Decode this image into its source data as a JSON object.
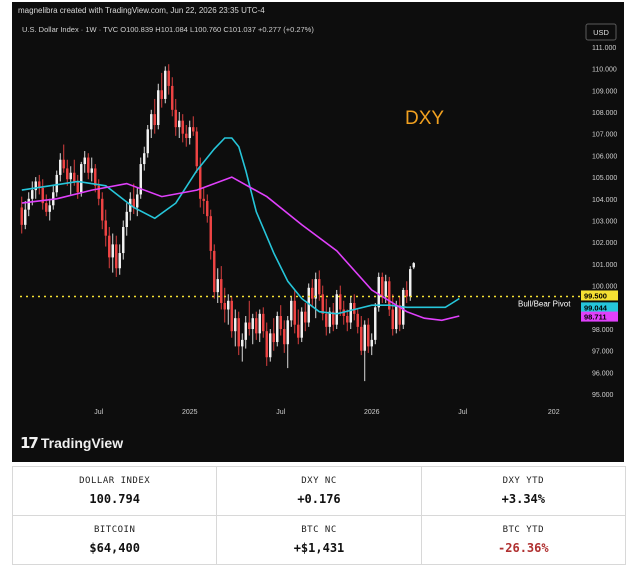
{
  "credit": "magnelibra created with TradingView.com, Jun 22, 2026 23:35 UTC-4",
  "brand": "TradingView",
  "chart_data": {
    "type": "candlestick",
    "header": "U.S. Dollar Index · 1W · TVC",
    "ohlc_text": {
      "o_label": "O",
      "o": "100.839",
      "h_label": "H",
      "h": "101.084",
      "l_label": "L",
      "l": "100.760",
      "c_label": "C",
      "c": "101.037",
      "change": "+0.277 (+0.27%)"
    },
    "currency_button": "USD",
    "annotation": "DXY",
    "pivot_label": "Bull/Bear Pivot",
    "pivot_value": 99.5,
    "ylim": [
      94.5,
      111.5
    ],
    "y_ticks": [
      "111.000",
      "110.000",
      "109.000",
      "108.000",
      "107.000",
      "106.000",
      "105.000",
      "104.000",
      "103.000",
      "102.000",
      "101.000",
      "100.000",
      "99.000",
      "98.000",
      "97.000",
      "96.000",
      "95.000"
    ],
    "x_ticks": [
      {
        "label": "Jul",
        "index": 22
      },
      {
        "label": "2025",
        "index": 48
      },
      {
        "label": "Jul",
        "index": 74
      },
      {
        "label": "2026",
        "index": 100
      },
      {
        "label": "Jul",
        "index": 126
      },
      {
        "label": "202",
        "index": 152
      }
    ],
    "price_tags": [
      {
        "label": "99.500",
        "value": 99.5,
        "color": "#f5e133",
        "text": "#000000"
      },
      {
        "label": "99.044",
        "value": 99.044,
        "color": "#26c6da",
        "text": "#000000"
      },
      {
        "label": "98.711",
        "value": 98.711,
        "color": "#e040fb",
        "text": "#000000"
      }
    ],
    "series": [
      {
        "role": "short-ma",
        "color": "#26c6da",
        "x": [
          0,
          8,
          16,
          24,
          32,
          38,
          44,
          50,
          55,
          58,
          60,
          62,
          64,
          67,
          72,
          76,
          80,
          85,
          90,
          95,
          100,
          105,
          110,
          115,
          119,
          121,
          123,
          125
        ],
        "y": [
          104.4,
          104.6,
          104.8,
          104.6,
          103.6,
          103.1,
          103.8,
          105.3,
          106.3,
          106.8,
          106.8,
          106.4,
          105.3,
          103.4,
          101.5,
          100.2,
          99.4,
          98.8,
          98.7,
          98.9,
          99.1,
          99.1,
          99.0,
          99.0,
          99.0,
          99.0,
          99.2,
          99.4
        ]
      },
      {
        "role": "long-ma",
        "color": "#e040fb",
        "x": [
          0,
          10,
          20,
          30,
          40,
          50,
          60,
          70,
          80,
          90,
          100,
          110,
          115,
          120,
          125
        ],
        "y": [
          103.8,
          104.0,
          104.4,
          104.7,
          104.1,
          104.4,
          105.0,
          104.1,
          102.8,
          101.6,
          99.8,
          98.8,
          98.5,
          98.4,
          98.6
        ]
      }
    ],
    "candles": [
      {
        "o": 103.6,
        "h": 104.1,
        "l": 102.4,
        "c": 102.8
      },
      {
        "o": 102.8,
        "h": 103.9,
        "l": 102.6,
        "c": 103.5
      },
      {
        "o": 103.5,
        "h": 104.3,
        "l": 103.2,
        "c": 104.0
      },
      {
        "o": 104.0,
        "h": 104.8,
        "l": 103.7,
        "c": 104.4
      },
      {
        "o": 104.4,
        "h": 105.0,
        "l": 104.0,
        "c": 104.8
      },
      {
        "o": 104.8,
        "h": 105.1,
        "l": 104.2,
        "c": 104.5
      },
      {
        "o": 104.5,
        "h": 104.9,
        "l": 103.5,
        "c": 103.8
      },
      {
        "o": 103.8,
        "h": 104.2,
        "l": 103.2,
        "c": 103.4
      },
      {
        "o": 103.4,
        "h": 104.0,
        "l": 103.0,
        "c": 103.7
      },
      {
        "o": 103.7,
        "h": 104.6,
        "l": 103.5,
        "c": 104.3
      },
      {
        "o": 104.3,
        "h": 105.3,
        "l": 104.1,
        "c": 105.1
      },
      {
        "o": 105.1,
        "h": 106.1,
        "l": 104.8,
        "c": 105.8
      },
      {
        "o": 105.8,
        "h": 106.5,
        "l": 105.2,
        "c": 105.4
      },
      {
        "o": 105.4,
        "h": 105.8,
        "l": 104.6,
        "c": 104.9
      },
      {
        "o": 104.9,
        "h": 105.5,
        "l": 104.2,
        "c": 105.2
      },
      {
        "o": 105.2,
        "h": 105.8,
        "l": 104.6,
        "c": 104.8
      },
      {
        "o": 104.8,
        "h": 105.1,
        "l": 104.0,
        "c": 104.3
      },
      {
        "o": 104.3,
        "h": 105.7,
        "l": 104.1,
        "c": 105.6
      },
      {
        "o": 105.6,
        "h": 106.2,
        "l": 105.2,
        "c": 105.9
      },
      {
        "o": 105.9,
        "h": 106.1,
        "l": 104.9,
        "c": 105.2
      },
      {
        "o": 105.2,
        "h": 105.9,
        "l": 104.8,
        "c": 105.4
      },
      {
        "o": 105.4,
        "h": 105.6,
        "l": 104.3,
        "c": 104.6
      },
      {
        "o": 104.6,
        "h": 104.9,
        "l": 103.7,
        "c": 104.0
      },
      {
        "o": 104.0,
        "h": 104.3,
        "l": 102.6,
        "c": 103.0
      },
      {
        "o": 103.0,
        "h": 103.5,
        "l": 101.8,
        "c": 102.3
      },
      {
        "o": 102.3,
        "h": 102.7,
        "l": 100.8,
        "c": 101.3
      },
      {
        "o": 101.3,
        "h": 102.4,
        "l": 100.6,
        "c": 101.9
      },
      {
        "o": 101.9,
        "h": 102.3,
        "l": 100.4,
        "c": 100.8
      },
      {
        "o": 100.8,
        "h": 101.9,
        "l": 100.5,
        "c": 101.5
      },
      {
        "o": 101.5,
        "h": 103.0,
        "l": 101.2,
        "c": 102.7
      },
      {
        "o": 102.7,
        "h": 103.8,
        "l": 102.3,
        "c": 103.4
      },
      {
        "o": 103.4,
        "h": 104.3,
        "l": 103.0,
        "c": 104.0
      },
      {
        "o": 104.0,
        "h": 104.7,
        "l": 103.3,
        "c": 103.6
      },
      {
        "o": 103.6,
        "h": 104.5,
        "l": 103.2,
        "c": 104.2
      },
      {
        "o": 104.2,
        "h": 105.9,
        "l": 104.0,
        "c": 105.6
      },
      {
        "o": 105.6,
        "h": 106.4,
        "l": 105.3,
        "c": 106.1
      },
      {
        "o": 106.1,
        "h": 107.4,
        "l": 105.9,
        "c": 107.2
      },
      {
        "o": 107.2,
        "h": 108.1,
        "l": 106.8,
        "c": 107.9
      },
      {
        "o": 107.9,
        "h": 108.6,
        "l": 107.0,
        "c": 107.4
      },
      {
        "o": 107.4,
        "h": 109.3,
        "l": 107.2,
        "c": 109.0
      },
      {
        "o": 109.0,
        "h": 109.8,
        "l": 108.2,
        "c": 108.6
      },
      {
        "o": 108.6,
        "h": 110.1,
        "l": 108.4,
        "c": 109.9
      },
      {
        "o": 109.9,
        "h": 110.2,
        "l": 108.8,
        "c": 109.2
      },
      {
        "o": 109.2,
        "h": 109.6,
        "l": 107.8,
        "c": 108.1
      },
      {
        "o": 108.1,
        "h": 108.6,
        "l": 106.9,
        "c": 107.3
      },
      {
        "o": 107.3,
        "h": 108.0,
        "l": 106.8,
        "c": 107.6
      },
      {
        "o": 107.6,
        "h": 107.9,
        "l": 106.6,
        "c": 107.0
      },
      {
        "o": 107.0,
        "h": 107.4,
        "l": 106.4,
        "c": 106.8
      },
      {
        "o": 106.8,
        "h": 107.6,
        "l": 106.5,
        "c": 107.3
      },
      {
        "o": 107.3,
        "h": 107.8,
        "l": 106.9,
        "c": 107.1
      },
      {
        "o": 107.1,
        "h": 107.3,
        "l": 105.2,
        "c": 105.5
      },
      {
        "o": 105.5,
        "h": 105.9,
        "l": 103.6,
        "c": 104.0
      },
      {
        "o": 104.0,
        "h": 104.5,
        "l": 103.3,
        "c": 103.9
      },
      {
        "o": 103.9,
        "h": 104.2,
        "l": 102.9,
        "c": 103.2
      },
      {
        "o": 103.2,
        "h": 103.5,
        "l": 101.2,
        "c": 101.6
      },
      {
        "o": 101.6,
        "h": 101.9,
        "l": 99.4,
        "c": 99.7
      },
      {
        "o": 99.7,
        "h": 100.8,
        "l": 99.2,
        "c": 100.3
      },
      {
        "o": 100.3,
        "h": 100.9,
        "l": 98.9,
        "c": 99.2
      },
      {
        "o": 99.2,
        "h": 99.9,
        "l": 98.3,
        "c": 98.9
      },
      {
        "o": 98.9,
        "h": 99.6,
        "l": 98.2,
        "c": 99.3
      },
      {
        "o": 99.3,
        "h": 99.5,
        "l": 97.6,
        "c": 97.9
      },
      {
        "o": 97.9,
        "h": 98.9,
        "l": 97.2,
        "c": 98.5
      },
      {
        "o": 98.5,
        "h": 98.8,
        "l": 96.8,
        "c": 97.2
      },
      {
        "o": 97.2,
        "h": 97.8,
        "l": 96.5,
        "c": 97.5
      },
      {
        "o": 97.5,
        "h": 98.6,
        "l": 97.1,
        "c": 98.3
      },
      {
        "o": 98.3,
        "h": 99.3,
        "l": 97.7,
        "c": 98.0
      },
      {
        "o": 98.0,
        "h": 98.7,
        "l": 97.3,
        "c": 98.5
      },
      {
        "o": 98.5,
        "h": 98.8,
        "l": 97.5,
        "c": 97.8
      },
      {
        "o": 97.8,
        "h": 98.9,
        "l": 97.4,
        "c": 98.7
      },
      {
        "o": 98.7,
        "h": 99.0,
        "l": 97.6,
        "c": 97.9
      },
      {
        "o": 97.9,
        "h": 98.3,
        "l": 96.3,
        "c": 96.7
      },
      {
        "o": 96.7,
        "h": 98.0,
        "l": 96.5,
        "c": 97.8
      },
      {
        "o": 97.8,
        "h": 98.5,
        "l": 97.0,
        "c": 97.4
      },
      {
        "o": 97.4,
        "h": 98.8,
        "l": 97.2,
        "c": 98.6
      },
      {
        "o": 98.6,
        "h": 99.1,
        "l": 97.7,
        "c": 98.0
      },
      {
        "o": 98.0,
        "h": 98.4,
        "l": 96.9,
        "c": 97.3
      },
      {
        "o": 97.3,
        "h": 98.6,
        "l": 96.2,
        "c": 98.4
      },
      {
        "o": 98.4,
        "h": 99.5,
        "l": 98.1,
        "c": 99.3
      },
      {
        "o": 99.3,
        "h": 99.8,
        "l": 97.8,
        "c": 98.2
      },
      {
        "o": 98.2,
        "h": 98.9,
        "l": 97.3,
        "c": 97.6
      },
      {
        "o": 97.6,
        "h": 99.0,
        "l": 97.4,
        "c": 98.8
      },
      {
        "o": 98.8,
        "h": 99.2,
        "l": 97.9,
        "c": 98.3
      },
      {
        "o": 98.3,
        "h": 100.1,
        "l": 98.1,
        "c": 99.9
      },
      {
        "o": 99.9,
        "h": 100.3,
        "l": 99.0,
        "c": 99.4
      },
      {
        "o": 99.4,
        "h": 100.6,
        "l": 98.5,
        "c": 100.3
      },
      {
        "o": 100.3,
        "h": 100.7,
        "l": 99.3,
        "c": 99.6
      },
      {
        "o": 99.6,
        "h": 100.0,
        "l": 98.4,
        "c": 98.7
      },
      {
        "o": 98.7,
        "h": 99.4,
        "l": 97.7,
        "c": 98.1
      },
      {
        "o": 98.1,
        "h": 99.0,
        "l": 97.8,
        "c": 98.8
      },
      {
        "o": 98.8,
        "h": 99.2,
        "l": 97.9,
        "c": 98.2
      },
      {
        "o": 98.2,
        "h": 99.8,
        "l": 98.0,
        "c": 99.6
      },
      {
        "o": 99.6,
        "h": 100.0,
        "l": 98.6,
        "c": 98.9
      },
      {
        "o": 98.9,
        "h": 99.3,
        "l": 98.2,
        "c": 98.6
      },
      {
        "o": 98.6,
        "h": 98.9,
        "l": 97.9,
        "c": 98.3
      },
      {
        "o": 98.3,
        "h": 99.5,
        "l": 98.0,
        "c": 99.2
      },
      {
        "o": 99.2,
        "h": 99.6,
        "l": 98.4,
        "c": 98.7
      },
      {
        "o": 98.7,
        "h": 98.9,
        "l": 97.8,
        "c": 98.1
      },
      {
        "o": 98.1,
        "h": 98.6,
        "l": 96.8,
        "c": 97.0
      },
      {
        "o": 97.0,
        "h": 98.4,
        "l": 95.6,
        "c": 98.2
      },
      {
        "o": 98.2,
        "h": 98.5,
        "l": 96.9,
        "c": 97.2
      },
      {
        "o": 97.2,
        "h": 97.8,
        "l": 96.8,
        "c": 97.5
      },
      {
        "o": 97.5,
        "h": 99.2,
        "l": 97.3,
        "c": 99.0
      },
      {
        "o": 99.0,
        "h": 100.6,
        "l": 98.8,
        "c": 100.4
      },
      {
        "o": 100.4,
        "h": 100.6,
        "l": 99.2,
        "c": 99.5
      },
      {
        "o": 99.5,
        "h": 100.5,
        "l": 99.2,
        "c": 100.2
      },
      {
        "o": 100.2,
        "h": 100.4,
        "l": 98.6,
        "c": 98.9
      },
      {
        "o": 98.9,
        "h": 99.6,
        "l": 97.7,
        "c": 98.0
      },
      {
        "o": 98.0,
        "h": 99.3,
        "l": 97.8,
        "c": 99.1
      },
      {
        "o": 99.1,
        "h": 99.5,
        "l": 97.9,
        "c": 98.2
      },
      {
        "o": 98.2,
        "h": 99.9,
        "l": 98.0,
        "c": 99.8
      },
      {
        "o": 99.8,
        "h": 100.2,
        "l": 99.2,
        "c": 99.5
      },
      {
        "o": 99.5,
        "h": 100.9,
        "l": 99.3,
        "c": 100.76
      },
      {
        "o": 100.839,
        "h": 101.084,
        "l": 100.76,
        "c": 101.037
      }
    ],
    "candle_colors": {
      "up": "#f2f2f2",
      "down": "#ef4444"
    },
    "start_index": 0
  },
  "stats": [
    [
      {
        "label": "DOLLAR INDEX",
        "value": "100.794",
        "negative": false
      },
      {
        "label": "DXY NC",
        "value": "+0.176",
        "negative": false
      },
      {
        "label": "DXY YTD",
        "value": "+3.34%",
        "negative": false
      }
    ],
    [
      {
        "label": "BITCOIN",
        "value": "$64,400",
        "negative": false
      },
      {
        "label": "BTC NC",
        "value": "+$1,431",
        "negative": false
      },
      {
        "label": "BTC YTD",
        "value": "-26.36%",
        "negative": true
      }
    ]
  ]
}
